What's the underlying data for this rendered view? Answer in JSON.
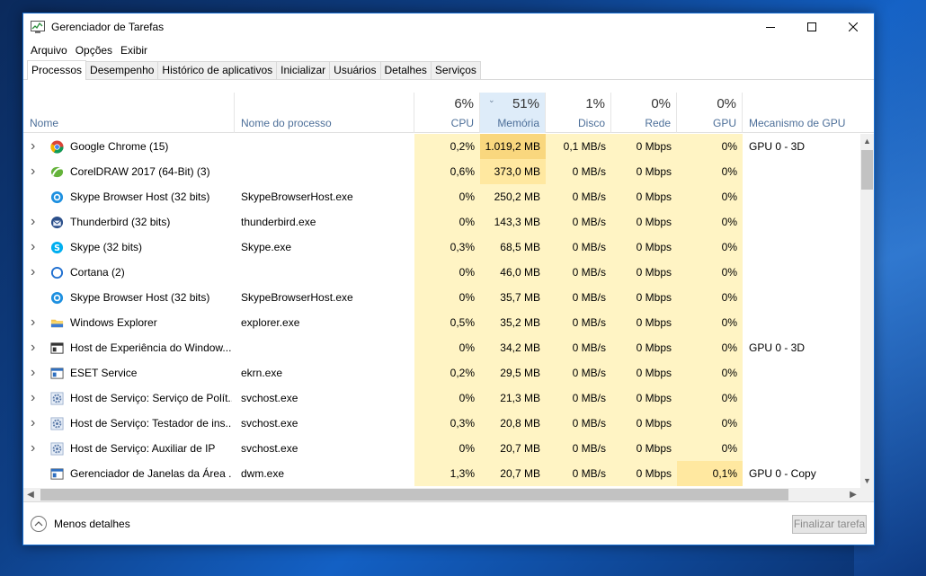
{
  "window": {
    "title": "Gerenciador de Tarefas"
  },
  "menu": [
    "Arquivo",
    "Opções",
    "Exibir"
  ],
  "tabs": [
    "Processos",
    "Desempenho",
    "Histórico de aplicativos",
    "Inicializar",
    "Usuários",
    "Detalhes",
    "Serviços"
  ],
  "active_tab": "Processos",
  "columns": {
    "name": "Nome",
    "process": "Nome do processo",
    "cpu": {
      "pct": "6%",
      "label": "CPU"
    },
    "mem": {
      "pct": "51%",
      "label": "Memória"
    },
    "disk": {
      "pct": "1%",
      "label": "Disco"
    },
    "net": {
      "pct": "0%",
      "label": "Rede"
    },
    "gpu": {
      "pct": "0%",
      "label": "GPU"
    },
    "engine": "Mecanismo de GPU"
  },
  "sorted_column": "mem",
  "rows": [
    {
      "name": "Google Chrome (15)",
      "process": "",
      "cpu": "0,2%",
      "mem": "1.019,2 MB",
      "disk": "0,1 MB/s",
      "net": "0 Mbps",
      "gpu": "0%",
      "engine": "GPU 0 - 3D",
      "icon": "chrome-icon",
      "expand": true,
      "hot": "mem2"
    },
    {
      "name": "CorelDRAW 2017 (64-Bit) (3)",
      "process": "",
      "cpu": "0,6%",
      "mem": "373,0 MB",
      "disk": "0 MB/s",
      "net": "0 Mbps",
      "gpu": "0%",
      "engine": "",
      "icon": "coreldraw-icon",
      "expand": true,
      "hot": "mem1"
    },
    {
      "name": "Skype Browser Host (32 bits)",
      "process": "SkypeBrowserHost.exe",
      "cpu": "0%",
      "mem": "250,2 MB",
      "disk": "0 MB/s",
      "net": "0 Mbps",
      "gpu": "0%",
      "engine": "",
      "icon": "skype-browser-icon",
      "expand": false,
      "hot": ""
    },
    {
      "name": "Thunderbird (32 bits)",
      "process": "thunderbird.exe",
      "cpu": "0%",
      "mem": "143,3 MB",
      "disk": "0 MB/s",
      "net": "0 Mbps",
      "gpu": "0%",
      "engine": "",
      "icon": "thunderbird-icon",
      "expand": true,
      "hot": ""
    },
    {
      "name": "Skype (32 bits)",
      "process": "Skype.exe",
      "cpu": "0,3%",
      "mem": "68,5 MB",
      "disk": "0 MB/s",
      "net": "0 Mbps",
      "gpu": "0%",
      "engine": "",
      "icon": "skype-icon",
      "expand": true,
      "hot": ""
    },
    {
      "name": "Cortana (2)",
      "process": "",
      "cpu": "0%",
      "mem": "46,0 MB",
      "disk": "0 MB/s",
      "net": "0 Mbps",
      "gpu": "0%",
      "engine": "",
      "icon": "cortana-icon",
      "expand": true,
      "hot": ""
    },
    {
      "name": "Skype Browser Host (32 bits)",
      "process": "SkypeBrowserHost.exe",
      "cpu": "0%",
      "mem": "35,7 MB",
      "disk": "0 MB/s",
      "net": "0 Mbps",
      "gpu": "0%",
      "engine": "",
      "icon": "skype-browser-icon",
      "expand": false,
      "hot": ""
    },
    {
      "name": "Windows Explorer",
      "process": "explorer.exe",
      "cpu": "0,5%",
      "mem": "35,2 MB",
      "disk": "0 MB/s",
      "net": "0 Mbps",
      "gpu": "0%",
      "engine": "",
      "icon": "folder-icon",
      "expand": true,
      "hot": ""
    },
    {
      "name": "Host de Experiência do Window...",
      "process": "",
      "cpu": "0%",
      "mem": "34,2 MB",
      "disk": "0 MB/s",
      "net": "0 Mbps",
      "gpu": "0%",
      "engine": "GPU 0 - 3D",
      "icon": "window-host-icon",
      "expand": true,
      "hot": ""
    },
    {
      "name": "ESET Service",
      "process": "ekrn.exe",
      "cpu": "0,2%",
      "mem": "29,5 MB",
      "disk": "0 MB/s",
      "net": "0 Mbps",
      "gpu": "0%",
      "engine": "",
      "icon": "service-window-icon",
      "expand": true,
      "hot": ""
    },
    {
      "name": "Host de Serviço: Serviço de Polít...",
      "process": "svchost.exe",
      "cpu": "0%",
      "mem": "21,3 MB",
      "disk": "0 MB/s",
      "net": "0 Mbps",
      "gpu": "0%",
      "engine": "",
      "icon": "gear-icon",
      "expand": true,
      "hot": ""
    },
    {
      "name": "Host de Serviço: Testador de ins...",
      "process": "svchost.exe",
      "cpu": "0,3%",
      "mem": "20,8 MB",
      "disk": "0 MB/s",
      "net": "0 Mbps",
      "gpu": "0%",
      "engine": "",
      "icon": "gear-icon",
      "expand": true,
      "hot": ""
    },
    {
      "name": "Host de Serviço: Auxiliar de IP",
      "process": "svchost.exe",
      "cpu": "0%",
      "mem": "20,7 MB",
      "disk": "0 MB/s",
      "net": "0 Mbps",
      "gpu": "0%",
      "engine": "",
      "icon": "gear-icon",
      "expand": true,
      "hot": ""
    },
    {
      "name": "Gerenciador de Janelas da Área ...",
      "process": "dwm.exe",
      "cpu": "1,3%",
      "mem": "20,7 MB",
      "disk": "0 MB/s",
      "net": "0 Mbps",
      "gpu": "0,1%",
      "engine": "GPU 0 - Copy",
      "icon": "service-window-icon",
      "expand": false,
      "hot": "gpu1"
    }
  ],
  "footer": {
    "less_details": "Menos detalhes",
    "end_task": "Finalizar tarefa"
  }
}
